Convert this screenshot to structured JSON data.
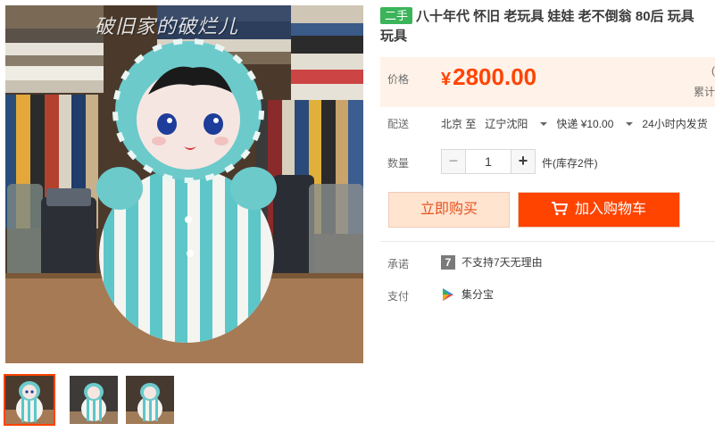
{
  "product": {
    "condition_tag": "二手",
    "title_line1": "八十年代 怀旧 老玩具 娃娃 老不倒翁 80后 玩具",
    "title_line2": "玩具",
    "watermark": "破旧家的破烂儿"
  },
  "price": {
    "label": "价格",
    "currency": "¥",
    "value": "2800.00",
    "extra_top": "(",
    "extra_bottom": "累计"
  },
  "delivery": {
    "label": "配送",
    "origin": "北京 至",
    "destination": "辽宁沈阳",
    "shipping": "快递 ¥10.00",
    "dispatch": "24小时内发货"
  },
  "quantity": {
    "label": "数量",
    "value": "1",
    "minus": "−",
    "plus": "+",
    "unit_stock": "件(库存2件)"
  },
  "actions": {
    "buy_now": "立即购买",
    "add_to_cart": "加入购物车"
  },
  "promise": {
    "label": "承诺",
    "icon_text": "7",
    "text": "不支持7天无理由"
  },
  "payment": {
    "label": "支付",
    "method": "集分宝"
  },
  "colors": {
    "accent": "#ff4400",
    "used_tag": "#3bb45a",
    "price_bg": "#fff2e8"
  },
  "icons": {
    "cart": "shopping-cart-icon",
    "promise": "seven-day-icon",
    "payment": "jifenbao-icon",
    "dropdown": "caret-down-icon"
  }
}
